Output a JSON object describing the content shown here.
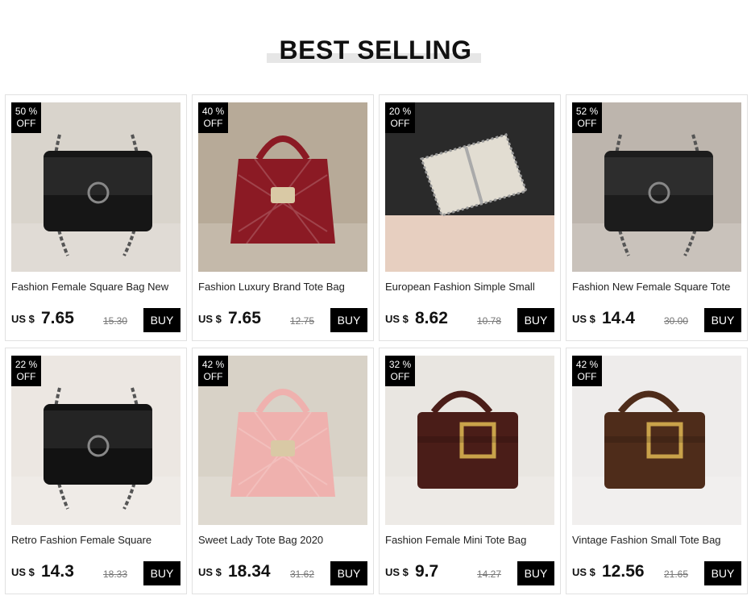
{
  "header": {
    "title": "BEST SELLING"
  },
  "products": [
    {
      "discount_pct": "50 %",
      "discount_off": "OFF",
      "name": "Fashion Female Square Bag New",
      "currency": "US $",
      "price": "7.65",
      "old_price": "15.30",
      "buy_label": "BUY",
      "bg": "#d9d4cc",
      "bag_color": "#161616",
      "photo_icon": "black-square-bag-icon"
    },
    {
      "discount_pct": "40 %",
      "discount_off": "OFF",
      "name": "Fashion Luxury Brand Tote Bag",
      "currency": "US $",
      "price": "7.65",
      "old_price": "12.75",
      "buy_label": "BUY",
      "bg": "#b7aa98",
      "bag_color": "#8b1a24",
      "photo_icon": "red-tote-bag-icon"
    },
    {
      "discount_pct": "20 %",
      "discount_off": "OFF",
      "name": "European Fashion Simple Small",
      "currency": "US $",
      "price": "8.62",
      "old_price": "10.78",
      "buy_label": "BUY",
      "bg": "#2a2a2a",
      "bag_color": "#e2ddd2",
      "photo_icon": "white-chain-bag-icon"
    },
    {
      "discount_pct": "52 %",
      "discount_off": "OFF",
      "name": "Fashion New Female Square Tote",
      "currency": "US $",
      "price": "14.4",
      "old_price": "30.00",
      "buy_label": "BUY",
      "bg": "#bdb5ad",
      "bag_color": "#1c1c1c",
      "photo_icon": "tweed-square-bag-icon"
    },
    {
      "discount_pct": "22 %",
      "discount_off": "OFF",
      "name": "Retro Fashion Female Square",
      "currency": "US $",
      "price": "14.3",
      "old_price": "18.33",
      "buy_label": "BUY",
      "bg": "#ece7e2",
      "bag_color": "#121212",
      "photo_icon": "black-retro-bag-icon"
    },
    {
      "discount_pct": "42 %",
      "discount_off": "OFF",
      "name": "Sweet Lady Tote Bag 2020",
      "currency": "US $",
      "price": "18.34",
      "old_price": "31.62",
      "buy_label": "BUY",
      "bg": "#d8d2c7",
      "bag_color": "#efb1ae",
      "photo_icon": "pink-tote-bag-icon"
    },
    {
      "discount_pct": "32 %",
      "discount_off": "OFF",
      "name": "Fashion Female Mini Tote Bag",
      "currency": "US $",
      "price": "9.7",
      "old_price": "14.27",
      "buy_label": "BUY",
      "bg": "#e9e6e1",
      "bag_color": "#4a1d18",
      "photo_icon": "brown-mini-tote-icon"
    },
    {
      "discount_pct": "42 %",
      "discount_off": "OFF",
      "name": "Vintage Fashion Small Tote Bag",
      "currency": "US $",
      "price": "12.56",
      "old_price": "21.65",
      "buy_label": "BUY",
      "bg": "#eeeceb",
      "bag_color": "#4e2c1a",
      "photo_icon": "brown-vintage-tote-icon"
    }
  ]
}
